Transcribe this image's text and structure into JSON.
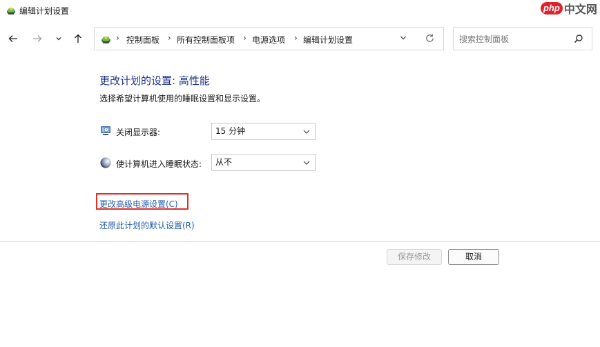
{
  "window": {
    "title": "编辑计划设置",
    "watermark_php": "php",
    "watermark_cn": "中文网"
  },
  "nav": {
    "back_icon": "arrow-left",
    "forward_icon": "arrow-right",
    "recent_icon": "chevron-down",
    "up_icon": "arrow-up"
  },
  "address": {
    "breadcrumbs": [
      "控制面板",
      "所有控制面板项",
      "电源选项",
      "编辑计划设置"
    ],
    "separator": "›"
  },
  "search": {
    "placeholder": "搜索控制面板",
    "value": ""
  },
  "main": {
    "title": "更改计划的设置: 高性能",
    "subtitle": "选择希望计算机使用的睡眠设置和显示设置。",
    "settings": [
      {
        "label": "关闭显示器:",
        "selected": "15 分钟",
        "icon": "monitor-icon"
      },
      {
        "label": "使计算机进入睡眠状态:",
        "selected": "从不",
        "icon": "moon-icon"
      }
    ],
    "links": {
      "advanced": "更改高级电源设置(C)",
      "restore": "还原此计划的默认设置(R)"
    }
  },
  "footer": {
    "save_label": "保存修改",
    "cancel_label": "取消"
  },
  "colors": {
    "title": "#1e3287",
    "link": "#1e5bb0",
    "highlight": "#e0302a"
  }
}
